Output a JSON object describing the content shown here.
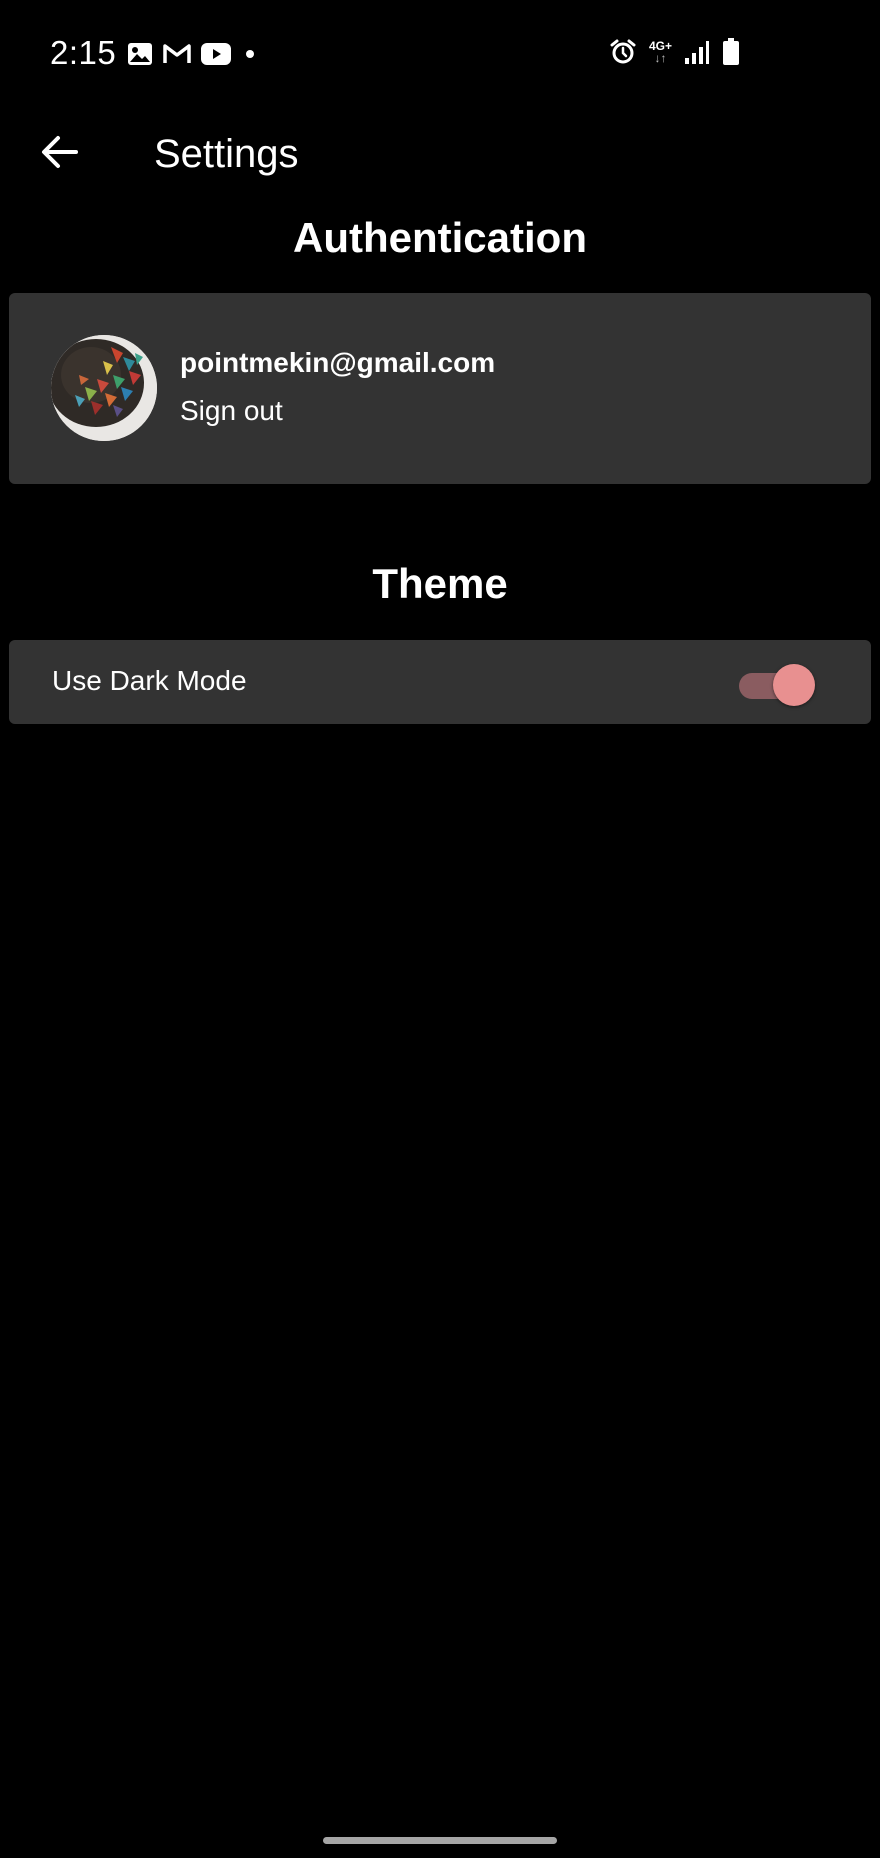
{
  "status_bar": {
    "time": "2:15",
    "left_icons": [
      "gallery-icon",
      "gmail-icon",
      "youtube-icon",
      "notification-dot-icon"
    ],
    "right_icons": [
      "alarm-icon",
      "network-4g-icon",
      "signal-icon",
      "battery-icon"
    ],
    "network_type": "4G+"
  },
  "app_bar": {
    "title": "Settings",
    "back_icon": "arrow-left-icon"
  },
  "authentication": {
    "heading": "Authentication",
    "email": "pointmekin@gmail.com",
    "sign_out_label": "Sign out"
  },
  "theme": {
    "heading": "Theme",
    "dark_mode_label": "Use Dark Mode",
    "dark_mode_enabled": true
  },
  "colors": {
    "background": "#000000",
    "card": "#333333",
    "toggle_thumb": "#e89090",
    "toggle_track": "#8a5c60",
    "nav_handle": "#a6a6a6"
  }
}
